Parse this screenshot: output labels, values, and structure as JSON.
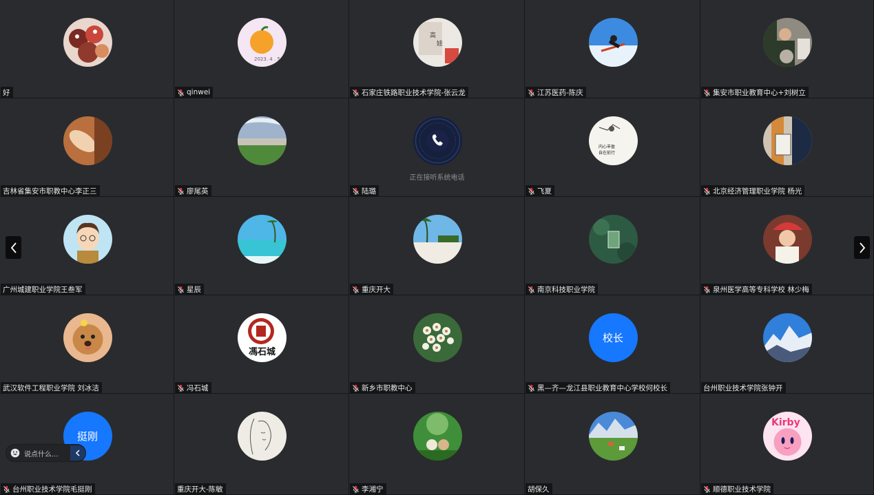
{
  "participants": [
    {
      "name": "好",
      "avatar": "cake-photo",
      "muted": false
    },
    {
      "name": "qinwei",
      "avatar": "orange-photo",
      "muted": true
    },
    {
      "name": "石家庄铁路职业技术学院-张云龙",
      "avatar": "room-photo",
      "muted": true
    },
    {
      "name": "江苏医药-陈庆",
      "avatar": "ski-photo",
      "muted": true
    },
    {
      "name": "集安市职业教育中心+刘树立",
      "avatar": "man-cat-photo",
      "muted": true
    },
    {
      "name": "吉林省集安市职教中心李正三",
      "avatar": "brown-photo",
      "muted": false
    },
    {
      "name": "廖尾英",
      "avatar": "field-photo",
      "muted": true
    },
    {
      "name": "陆璐",
      "avatar": "phone-icon",
      "muted": true,
      "status": "正在接听系统电话"
    },
    {
      "name": "飞夏",
      "avatar": "sketch-photo",
      "muted": true
    },
    {
      "name": "北京经济管理职业学院 杨光",
      "avatar": "bag-photo",
      "muted": true
    },
    {
      "name": "广州城建职业学院王叁军",
      "avatar": "cartoon-photo",
      "muted": false
    },
    {
      "name": "星辰",
      "avatar": "beach-photo",
      "muted": true
    },
    {
      "name": "重庆开大",
      "avatar": "palm-photo",
      "muted": true
    },
    {
      "name": "南京科技职业学院",
      "avatar": "aerial-photo",
      "muted": true
    },
    {
      "name": "泉州医学高等专科学校 林少梅",
      "avatar": "child-photo",
      "muted": true
    },
    {
      "name": "武汉软件工程职业学院 刘冰洁",
      "avatar": "dog-photo",
      "muted": false
    },
    {
      "name": "冯石城",
      "avatar": "seal-photo",
      "muted": true
    },
    {
      "name": "新乡市职教中心",
      "avatar": "flower-photo",
      "muted": true
    },
    {
      "name": "黑—齐—龙江县职业教育中心学校何校长",
      "avatar": "text",
      "avatar_text": "校长",
      "muted": true
    },
    {
      "name": "台州职业技术学院张钟开",
      "avatar": "mountain-photo",
      "muted": false
    },
    {
      "name": "台州职业技术学院毛挺刚",
      "avatar": "text",
      "avatar_text": "挺刚",
      "muted": true
    },
    {
      "name": "重庆开大-陈敏",
      "avatar": "drawing-photo",
      "muted": false
    },
    {
      "name": "李湘宁",
      "avatar": "puppies-photo",
      "muted": true
    },
    {
      "name": "胡保久",
      "avatar": "village-photo",
      "muted": false
    },
    {
      "name": "顺德职业技术学院",
      "avatar": "kirby-photo",
      "muted": true
    }
  ],
  "chat": {
    "placeholder": "说点什么..."
  },
  "icons": {
    "prev": "chevron-left-icon",
    "next": "chevron-right-icon",
    "mic": "mic-muted-icon",
    "emoji": "emoji-icon",
    "collapse": "chevron-left-icon"
  },
  "colors": {
    "tile": "#2a2b2e",
    "accent": "#1677ff",
    "mic": "#d9363e"
  }
}
